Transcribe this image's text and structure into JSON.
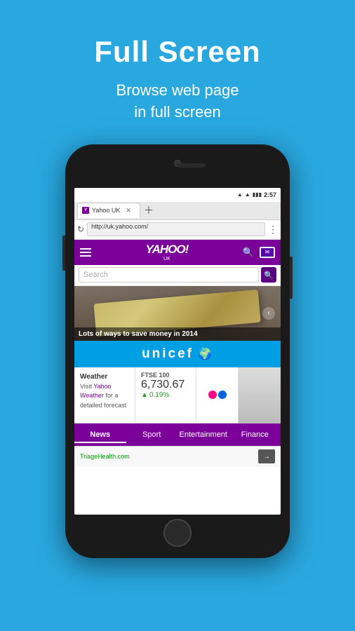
{
  "page": {
    "title": "Full Screen",
    "subtitle": "Browse web page\nin full screen"
  },
  "phone": {
    "status": {
      "time": "2:57",
      "battery": "■",
      "wifi": "▲"
    },
    "tab": {
      "label": "Yahoo UK",
      "url": "http://uk.yahoo.com/"
    },
    "yahoo": {
      "logo": "YAHOO!",
      "uk": "UK",
      "search_placeholder": "Search"
    },
    "hero": {
      "caption": "Lots of ways to save money in 2014"
    },
    "unicef": {
      "label": "unicef"
    },
    "weather": {
      "title": "Weather",
      "text": "Visit ",
      "link": "Yahoo Weather",
      "text2": " for a detailed forecast"
    },
    "ftse": {
      "title": "FTSE 100",
      "value": "6,730.67",
      "change": "0.19%"
    },
    "nav_tabs": [
      {
        "label": "News",
        "active": true
      },
      {
        "label": "Sport",
        "active": false
      },
      {
        "label": "Entertainment",
        "active": false
      },
      {
        "label": "Finance",
        "active": false
      }
    ],
    "bottom": {
      "text": "TriageHealth.com",
      "arrow": "→"
    }
  }
}
